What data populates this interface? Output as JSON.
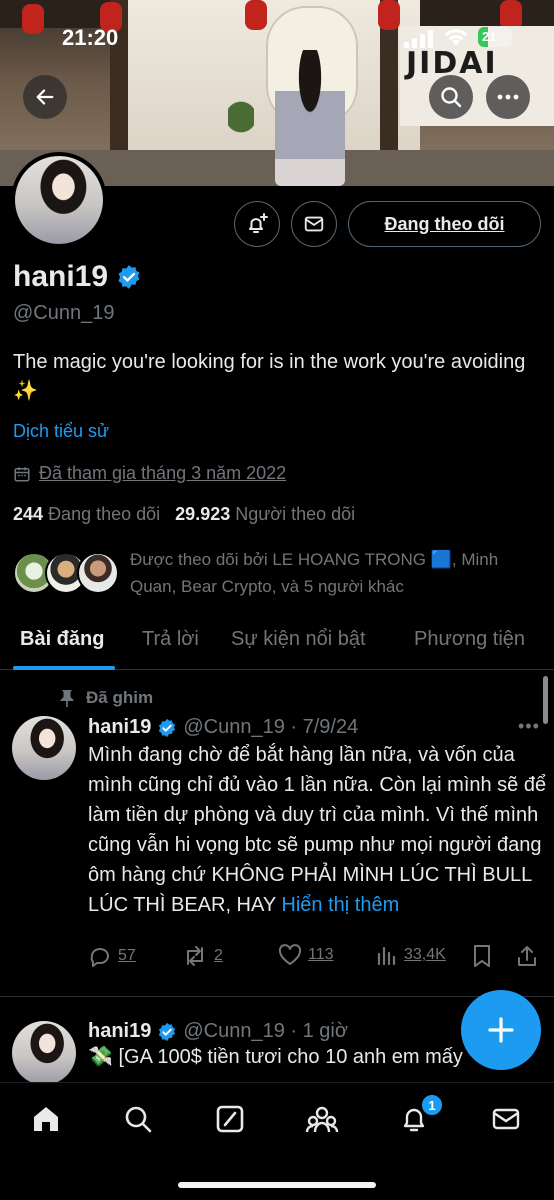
{
  "status_bar": {
    "time": "21:20",
    "battery": "21"
  },
  "banner": {
    "sign_text": "JIDAI"
  },
  "profile": {
    "display_name": "hani19",
    "handle": "@Cunn_19",
    "bio": "The magic you're looking for is in the work you're avoiding ✨",
    "translate_bio": "Dịch tiểu sử",
    "joined": "Đã tham gia tháng 3 năm 2022",
    "following_count": "244",
    "following_label": "Đang theo dõi",
    "followers_count": "29.923",
    "followers_label": "Người theo dõi",
    "followed_by": "Được theo dõi bởi LE HOANG TRONG 🟦, Minh Quan, Bear Crypto, và 5 người khác",
    "follow_button": "Đang theo dõi"
  },
  "tabs": [
    {
      "label": "Bài đăng",
      "active": true
    },
    {
      "label": "Trả lời",
      "active": false
    },
    {
      "label": "Sự kiện nổi bật",
      "active": false
    },
    {
      "label": "Phương tiện",
      "active": false
    }
  ],
  "posts": [
    {
      "pinned_label": "Đã ghim",
      "name": "hani19",
      "handle": "@Cunn_19",
      "time": "7/9/24",
      "text": "Mình đang chờ để bắt  hàng lần nữa, và vốn của mình cũng chỉ đủ vào 1 lần nữa. Còn lại mình sẽ để làm tiền dự phòng và duy trì của mình. Vì thế mình cũng vẫn hi vọng btc sẽ pump như mọi người đang ôm hàng chứ KHÔNG PHẢI MÌNH LÚC THÌ BULL LÚC THÌ BEAR, HAY",
      "show_more": "Hiển thị thêm",
      "replies": "57",
      "reposts": "2",
      "likes": "113",
      "views": "33,4K"
    },
    {
      "name": "hani19",
      "handle": "@Cunn_19",
      "time": "1 giờ",
      "text": "💸 [GA 100$ tiền tươi cho 10 anh em mấy"
    }
  ],
  "nav": {
    "notifications_badge": "1"
  },
  "icons": [
    "back-icon",
    "search-icon",
    "more-icon",
    "notify-plus-icon",
    "mail-icon",
    "verified-icon",
    "calendar-icon",
    "pin-icon",
    "reply-icon",
    "repost-icon",
    "like-icon",
    "views-icon",
    "bookmark-icon",
    "share-icon",
    "compose-plus-icon",
    "home-icon",
    "explore-icon",
    "grok-icon",
    "communities-icon",
    "bell-icon",
    "messages-icon"
  ],
  "colors": {
    "accent": "#1d9bf0",
    "muted": "#71767b",
    "text": "#e7e9ea",
    "background": "#000000"
  }
}
